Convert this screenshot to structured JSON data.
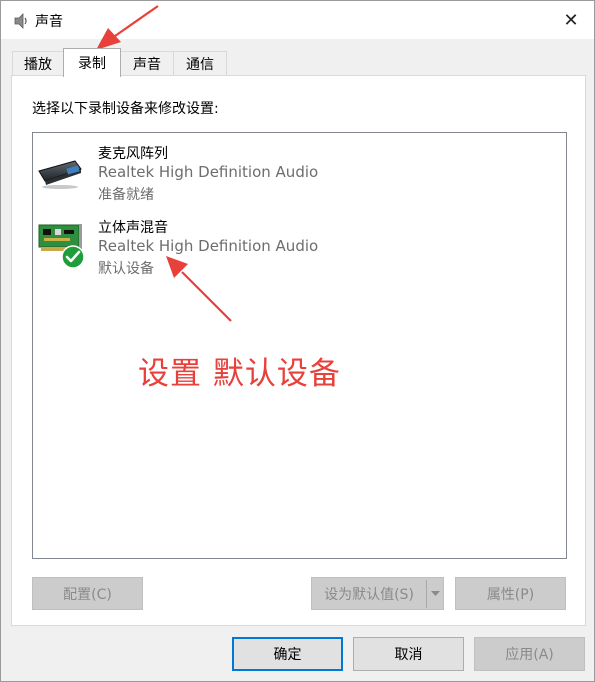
{
  "window": {
    "title": "声音",
    "close_label": "✕"
  },
  "tabs": [
    {
      "label": "播放",
      "active": false
    },
    {
      "label": "录制",
      "active": true
    },
    {
      "label": "声音",
      "active": false
    },
    {
      "label": "通信",
      "active": false
    }
  ],
  "panel": {
    "instruction": "选择以下录制设备来修改设置:",
    "devices": [
      {
        "name": "麦克风阵列",
        "driver": "Realtek High Definition Audio",
        "status": "准备就绪",
        "icon": "microphone-array-icon"
      },
      {
        "name": "立体声混音",
        "driver": "Realtek High Definition Audio",
        "status": "默认设备",
        "icon": "sound-card-icon",
        "default_badge": "green-check-icon"
      }
    ]
  },
  "annotation": {
    "text": "设置 默认设备",
    "color": "#e8403a"
  },
  "buttons": {
    "configure": "配置(C)",
    "set_default": "设为默认值(S)",
    "properties": "属性(P)",
    "ok": "确定",
    "cancel": "取消",
    "apply": "应用(A)"
  },
  "colors": {
    "accent": "#0078d7",
    "annotation_red": "#e8403a",
    "check_green": "#1e9e3a"
  }
}
